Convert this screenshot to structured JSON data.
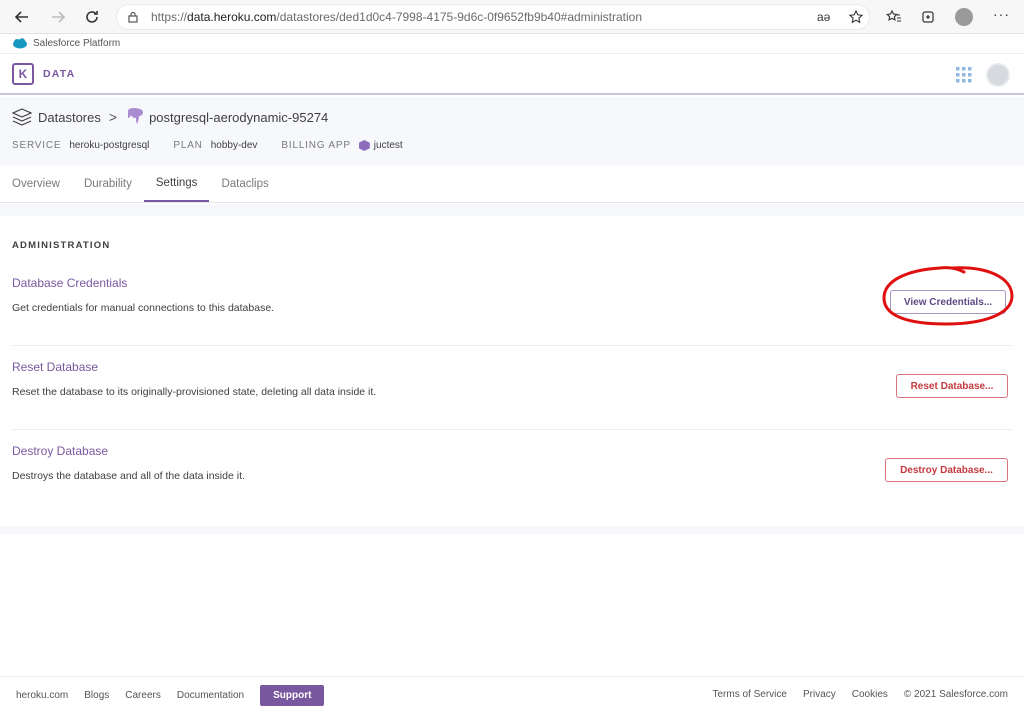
{
  "browser": {
    "url_prefix": "https://",
    "url_domain": "data.heroku.com",
    "url_path": "/datastores/ded1d0c4-7998-4175-9d6c-0f9652fb9b40#administration"
  },
  "salesforce": {
    "label": "Salesforce Platform"
  },
  "header": {
    "product_label": "DATA",
    "logo_letter": "K"
  },
  "breadcrumb": {
    "root": "Datastores",
    "separator": ">",
    "database": "postgresql-aerodynamic-95274"
  },
  "meta": {
    "service_key": "SERVICE",
    "service_value": "heroku-postgresql",
    "plan_key": "PLAN",
    "plan_value": "hobby-dev",
    "billing_key": "BILLING APP",
    "billing_value": "juctest"
  },
  "tabs": [
    {
      "label": "Overview"
    },
    {
      "label": "Durability"
    },
    {
      "label": "Settings",
      "active": true
    },
    {
      "label": "Dataclips"
    }
  ],
  "administration": {
    "title": "ADMINISTRATION",
    "rows": [
      {
        "title": "Database Credentials",
        "desc": "Get credentials for manual connections to this database.",
        "button": "View Credentials..."
      },
      {
        "title": "Reset Database",
        "desc": "Reset the database to its originally-provisioned state, deleting all data inside it.",
        "button": "Reset Database..."
      },
      {
        "title": "Destroy Database",
        "desc": "Destroys the database and all of the data inside it.",
        "button": "Destroy Database..."
      }
    ]
  },
  "footer": {
    "links": [
      "heroku.com",
      "Blogs",
      "Careers",
      "Documentation"
    ],
    "support": "Support",
    "right_links": [
      "Terms of Service",
      "Privacy",
      "Cookies"
    ],
    "copyright": "© 2021 Salesforce.com"
  },
  "colors": {
    "accent": "#79589f",
    "danger": "#c43a3f",
    "annotation": "#e01010"
  }
}
